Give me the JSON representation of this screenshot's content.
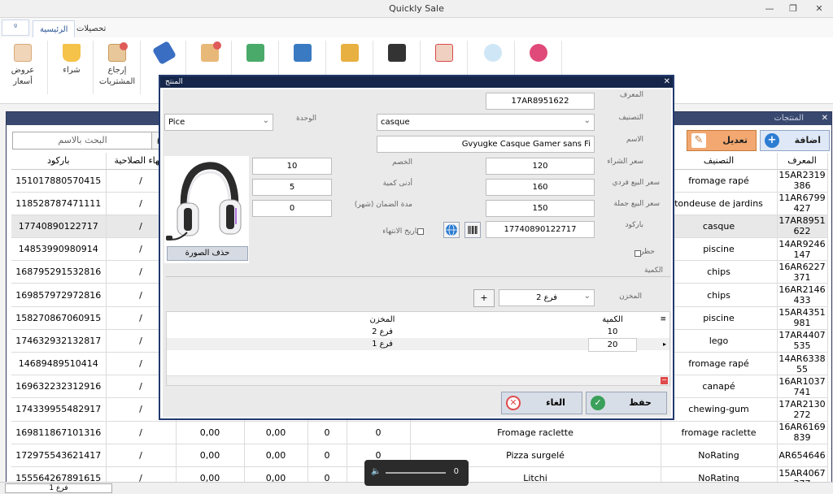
{
  "window": {
    "title": "Quickly Sale",
    "minimize": "—",
    "restore": "❐",
    "close": "✕"
  },
  "ribbon": {
    "quick_access_glyph": "ᵍ",
    "tabs": [
      {
        "label": "الرئيسية",
        "active": true
      },
      {
        "label": "تحصيلات",
        "active": false
      }
    ],
    "buttons": [
      {
        "label": "عروض أسعار",
        "icon": "price-offer-icon",
        "color": "#e8b07a"
      },
      {
        "label": "شراء",
        "icon": "cart-icon",
        "color": "#f5a623"
      },
      {
        "label": "إرجاع المشتريات",
        "icon": "return-purchase-icon",
        "color": "#e05a5a"
      },
      {
        "label": "",
        "icon": "tags-icon",
        "color": "#3a6ec2"
      },
      {
        "label": "",
        "icon": "box-icon",
        "color": "#d77a3a"
      },
      {
        "label": "",
        "icon": "money-icon",
        "color": "#3aa05a"
      },
      {
        "label": "",
        "icon": "register-icon",
        "color": "#3a7ac2"
      },
      {
        "label": "",
        "icon": "folder-icon",
        "color": "#e0a040"
      },
      {
        "label": "",
        "icon": "store-icon",
        "color": "#333333"
      },
      {
        "label": "",
        "icon": "chart-icon",
        "color": "#d64a4a"
      },
      {
        "label": "",
        "icon": "palette-icon",
        "color": "#4a9ad6"
      },
      {
        "label": "",
        "icon": "power-icon",
        "color": "#e04a7a"
      }
    ]
  },
  "products_window": {
    "title": "المنتجات",
    "search_placeholder": "البحث بالاسم",
    "search_glyph": "ρ",
    "add_label": "اضافة",
    "edit_label": "تعديل",
    "columns": [
      "باركود",
      "انتهاء الصلاحية",
      "",
      "",
      "",
      "",
      "",
      "التصنيف",
      "المعرف"
    ],
    "rows": [
      {
        "barcode": "151017880570415",
        "exp": "/",
        "c3": "",
        "c4": "",
        "c5": "",
        "c6": "",
        "name": "",
        "category": "fromage rapé",
        "id": "15AR2319 386"
      },
      {
        "barcode": "118528787471111",
        "exp": "/",
        "c3": "",
        "c4": "",
        "c5": "",
        "c6": "",
        "name": "",
        "category": "tondeuse de jardins",
        "id": "11AR6799 427"
      },
      {
        "barcode": "17740890122717",
        "exp": "/",
        "c3": "",
        "c4": "",
        "c5": "",
        "c6": "",
        "name": "",
        "category": "casque",
        "id": "17AR8951 622",
        "selected": true
      },
      {
        "barcode": "14853990980914",
        "exp": "/",
        "c3": "",
        "c4": "",
        "c5": "",
        "c6": "",
        "name": "",
        "category": "piscine",
        "id": "14AR9246 147"
      },
      {
        "barcode": "168795291532816",
        "exp": "/",
        "c3": "",
        "c4": "",
        "c5": "",
        "c6": "",
        "name": "",
        "category": "chips",
        "id": "16AR6227 371"
      },
      {
        "barcode": "169857972972816",
        "exp": "/",
        "c3": "",
        "c4": "",
        "c5": "",
        "c6": "",
        "name": "",
        "category": "chips",
        "id": "16AR2146 433"
      },
      {
        "barcode": "158270867060915",
        "exp": "/",
        "c3": "",
        "c4": "",
        "c5": "",
        "c6": "",
        "name": "",
        "category": "piscine",
        "id": "15AR4351 981"
      },
      {
        "barcode": "174632932132817",
        "exp": "/",
        "c3": "",
        "c4": "",
        "c5": "",
        "c6": "",
        "name": "",
        "category": "lego",
        "id": "17AR4407 535"
      },
      {
        "barcode": "14689489510414",
        "exp": "/",
        "c3": "",
        "c4": "",
        "c5": "",
        "c6": "",
        "name": "",
        "category": "fromage rapé",
        "id": "14AR6338 55"
      },
      {
        "barcode": "169632232312916",
        "exp": "/",
        "c3": "",
        "c4": "",
        "c5": "",
        "c6": "",
        "name": "",
        "category": "canapé",
        "id": "16AR1037 741"
      },
      {
        "barcode": "174339955482917",
        "exp": "/",
        "c3": "",
        "c4": "",
        "c5": "",
        "c6": "",
        "name": "",
        "category": "chewing-gum",
        "id": "17AR2130 272"
      },
      {
        "barcode": "169811867101316",
        "exp": "/",
        "c3": "0,00",
        "c4": "0,00",
        "c5": "0",
        "c6": "0",
        "name": "Fromage raclette",
        "category": "fromage raclette",
        "id": "16AR6169 839"
      },
      {
        "barcode": "172975543621417",
        "exp": "/",
        "c3": "0,00",
        "c4": "0,00",
        "c5": "0",
        "c6": "0",
        "name": "Pizza surgelé",
        "category": "NoRating",
        "id": "AR654646"
      },
      {
        "barcode": "155564267891615",
        "exp": "/",
        "c3": "0,00",
        "c4": "0,00",
        "c5": "0",
        "c6": "0",
        "name": "Litchi",
        "category": "NoRating",
        "id": "15AR4067 377"
      }
    ]
  },
  "status": {
    "branch_select": "فرع 1"
  },
  "media": {
    "speaker_glyph": "🔈",
    "volume": "0"
  },
  "dialog": {
    "title": "المنتج",
    "labels": {
      "id": "المعرف",
      "category": "التصنيف",
      "name": "الاسم",
      "purchase_price": "سعر الشراء",
      "unit_price": "سعر البيع فردي",
      "wholesale_price": "سعر البيع جملة",
      "barcode": "باركود",
      "block": "حظر",
      "unit": "الوحدة",
      "discount": "الخصم",
      "min_qty": "أدنى كمية",
      "warranty": "مدة الضمان (شهر)",
      "expiry": "تاريخ الانتهاء",
      "quantity_group": "الكمية",
      "store": "المخزن",
      "col_qty": "الكمية",
      "col_store": "المخزن"
    },
    "values": {
      "id": "17AR8951622",
      "category": "casque",
      "name": "Gvyugke Casque Gamer sans Fi",
      "purchase_price": "120",
      "unit_price": "160",
      "wholesale_price": "150",
      "barcode": "17740890122717",
      "unit": "Pice",
      "discount": "10",
      "min_qty": "5",
      "warranty": "0",
      "store": "فرع 2"
    },
    "delete_image": "حذف الصورة",
    "plus": "+",
    "stock": [
      {
        "qty": "10",
        "store": "فرع 2"
      },
      {
        "qty": "20",
        "store": "فرع 1"
      }
    ],
    "save": "حفظ",
    "cancel": "الغاء"
  }
}
